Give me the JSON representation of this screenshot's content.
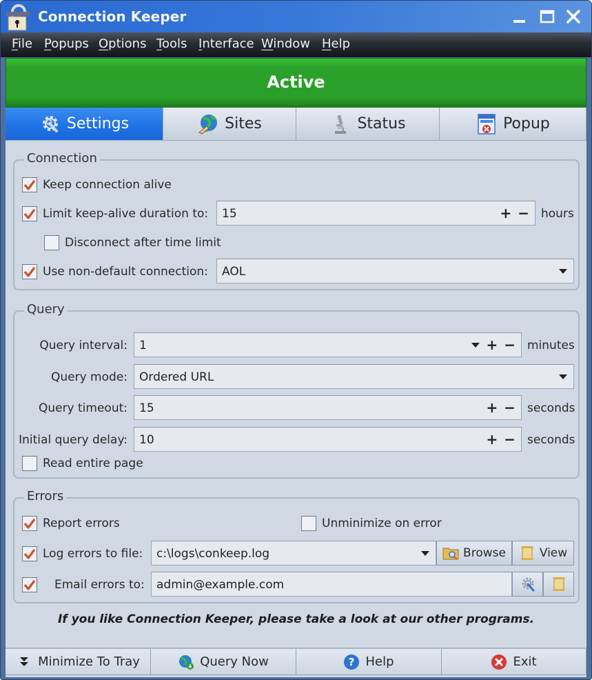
{
  "window": {
    "title": "Connection Keeper",
    "controls": {
      "minimize": "minimize",
      "maximize": "maximize",
      "close": "close"
    }
  },
  "menu": [
    {
      "label": "File",
      "mnemonic": "F",
      "rest": "ile"
    },
    {
      "label": "Popups",
      "mnemonic": "P",
      "rest": "opups"
    },
    {
      "label": "Options",
      "mnemonic": "O",
      "rest": "ptions"
    },
    {
      "label": "Tools",
      "mnemonic": "T",
      "rest": "ools"
    },
    {
      "label": "Interface",
      "mnemonic": "I",
      "rest": "nterface"
    },
    {
      "label": "Window",
      "mnemonic": "W",
      "rest": "indow"
    },
    {
      "label": "Help",
      "mnemonic": "H",
      "rest": "elp"
    }
  ],
  "status": {
    "text": "Active",
    "color": "#2aa12a"
  },
  "tabs": [
    {
      "label": "Settings",
      "icon": "settings-gear-icon",
      "active": true
    },
    {
      "label": "Sites",
      "icon": "globe-hand-icon",
      "active": false
    },
    {
      "label": "Status",
      "icon": "microscope-icon",
      "active": false
    },
    {
      "label": "Popup",
      "icon": "popup-window-icon",
      "active": false
    }
  ],
  "connection": {
    "group_label": "Connection",
    "keep_alive": {
      "label": "Keep connection alive",
      "checked": true
    },
    "limit_duration": {
      "label": "Limit keep-alive duration to:",
      "checked": true,
      "value": "15",
      "unit": "hours"
    },
    "disconnect_after": {
      "label": "Disconnect after time limit",
      "checked": false
    },
    "non_default": {
      "label": "Use non-default connection:",
      "checked": true,
      "value": "AOL"
    }
  },
  "query": {
    "group_label": "Query",
    "interval": {
      "label": "Query interval:",
      "value": "1",
      "unit": "minutes"
    },
    "mode": {
      "label": "Query mode:",
      "value": "Ordered URL"
    },
    "timeout": {
      "label": "Query timeout:",
      "value": "15",
      "unit": "seconds"
    },
    "initial_delay": {
      "label": "Initial query delay:",
      "value": "10",
      "unit": "seconds"
    },
    "read_entire_page": {
      "label": "Read entire page",
      "checked": false
    }
  },
  "errors": {
    "group_label": "Errors",
    "report": {
      "label": "Report errors",
      "checked": true
    },
    "unminimize": {
      "label": "Unminimize on error",
      "checked": false
    },
    "log_to_file": {
      "label": "Log errors to file:",
      "checked": true,
      "value": "c:\\logs\\conkeep.log",
      "browse_label": "Browse",
      "view_label": "View"
    },
    "email": {
      "label": "Email errors to:",
      "checked": true,
      "value": "admin@example.com"
    }
  },
  "controls": {
    "plus": "+",
    "minus": "−"
  },
  "promo_text": "If you like Connection Keeper, please take a look at our other programs.",
  "bottom_buttons": [
    {
      "label": "Minimize To Tray",
      "icon": "minimize-tray-icon"
    },
    {
      "label": "Query Now",
      "icon": "globe-download-icon"
    },
    {
      "label": "Help",
      "icon": "help-icon"
    },
    {
      "label": "Exit",
      "icon": "exit-icon"
    }
  ],
  "colors": {
    "titlebar": "#2a6ad2",
    "active_tab": "#1f72e6",
    "status_green": "#2aa12a",
    "checkmark": "#c9532a",
    "panel_bg": "#cfd8e3"
  }
}
